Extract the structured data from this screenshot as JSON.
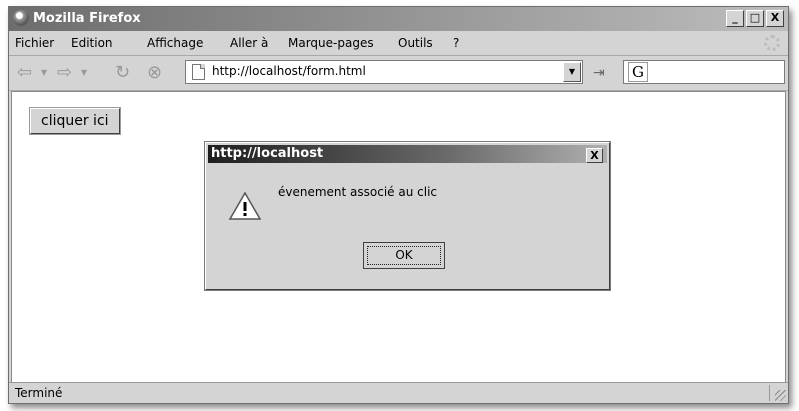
{
  "window": {
    "title": "Mozilla Firefox",
    "controls": [
      "_",
      "□",
      "X"
    ]
  },
  "menubar": {
    "items": [
      {
        "label": "Fichier"
      },
      {
        "label": "Edition"
      },
      {
        "label": "Affichage"
      },
      {
        "label": "Aller à"
      },
      {
        "label": "Marque-pages"
      },
      {
        "label": "Outils"
      },
      {
        "label": "?"
      }
    ]
  },
  "navbar": {
    "url": "http://localhost/form.html",
    "icons": [
      "back-arrow-icon",
      "forward-arrow-icon",
      "reload-icon",
      "stop-icon",
      "page-icon",
      "go-icon",
      "google-search-icon"
    ],
    "search_engine_glyph": "G"
  },
  "page": {
    "button_label": "cliquer ici"
  },
  "dialog": {
    "title": "http://localhost",
    "close_label": "X",
    "message": "évenement associé au clic",
    "ok_label": "OK",
    "icon": "warning-icon"
  },
  "statusbar": {
    "text": "Terminé"
  }
}
